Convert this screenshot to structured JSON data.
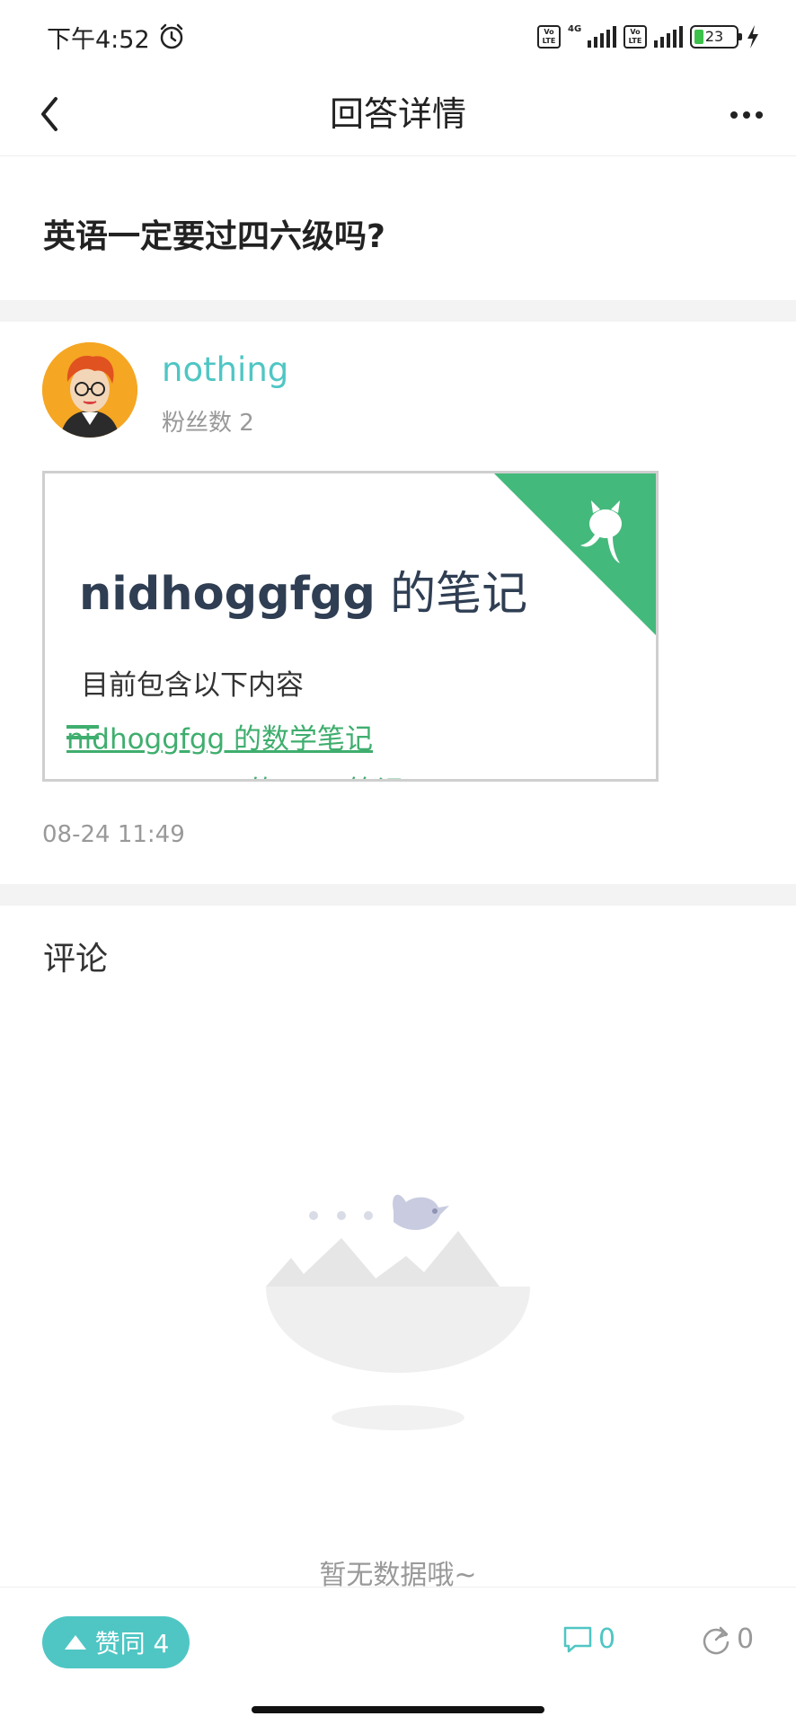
{
  "status_bar": {
    "time": "下午4:52",
    "network": "4G",
    "volte_label": "Vo LTE",
    "battery": "23"
  },
  "nav": {
    "title": "回答详情"
  },
  "question": {
    "title": "英语一定要过四六级吗?"
  },
  "answer": {
    "author": "nothing",
    "fans": "粉丝数 2",
    "card": {
      "title_en": "nidhoggfgg",
      "title_zh": " 的笔记",
      "subtitle": "目前包含以下内容",
      "link1": "nidhoggfgg 的数学笔记",
      "link2": "nidhoggfgg 的 rust 笔记"
    },
    "time": "08-24 11:49"
  },
  "comments": {
    "title": "评论",
    "empty_text": "暂无数据哦~"
  },
  "bottom_bar": {
    "like_label": "赞同 4",
    "comment_count": "0",
    "share_count": "0"
  },
  "colors": {
    "accent": "#4fc6c4",
    "card_green": "#44b97c",
    "text_dark": "#222222",
    "muted": "#999999"
  }
}
